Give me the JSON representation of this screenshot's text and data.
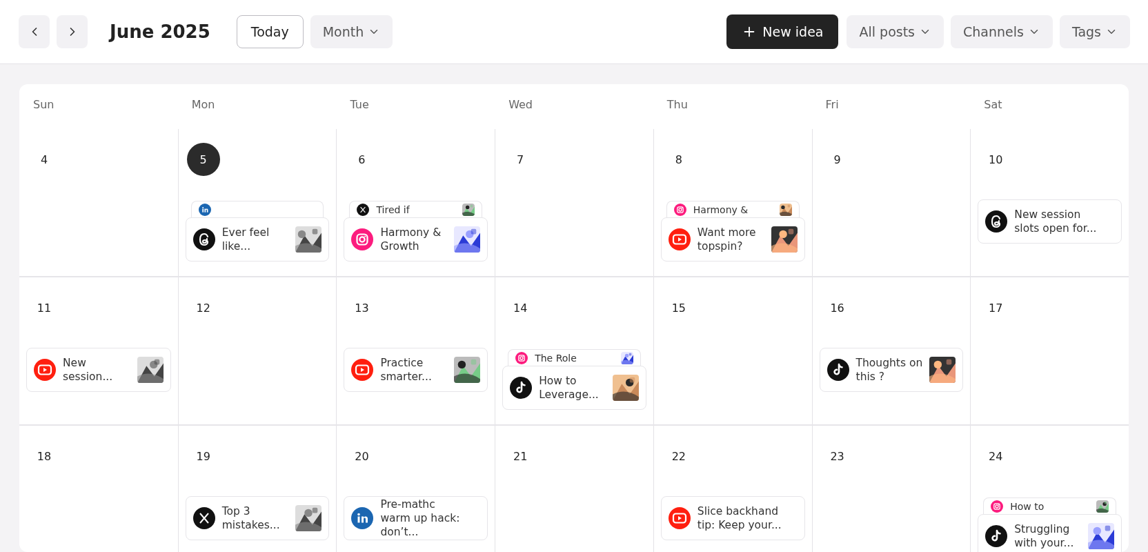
{
  "toolbar": {
    "title": "June 2025",
    "today": "Today",
    "view": "Month",
    "new_idea": "New idea",
    "filters": [
      "All posts",
      "Channels",
      "Tags"
    ]
  },
  "weekdays": [
    "Sun",
    "Mon",
    "Tue",
    "Wed",
    "Thu",
    "Fri",
    "Sat"
  ],
  "weeks": [
    {
      "days": [
        {
          "date": "4",
          "today": false
        },
        {
          "date": "5",
          "today": true,
          "posts": [
            {
              "kind": "linkedin",
              "thumbnail": false
            },
            {
              "kind": "threads",
              "title": "Ever feel like...",
              "thumbnail": true
            }
          ]
        },
        {
          "date": "6",
          "today": false,
          "posts": [
            {
              "kind": "x",
              "title": "Tired if",
              "thumbnail": true
            },
            {
              "kind": "instagram",
              "title": "Harmony & Growth",
              "thumbnail": true
            }
          ]
        },
        {
          "date": "7",
          "today": false
        },
        {
          "date": "8",
          "today": false,
          "posts": [
            {
              "kind": "instagram",
              "title": "Harmony &",
              "thumbnail": true
            },
            {
              "kind": "youtube",
              "title": "Want more topspin?",
              "thumbnail": true
            }
          ]
        },
        {
          "date": "9",
          "today": false
        },
        {
          "date": "10",
          "today": false,
          "posts": [
            {
              "kind": "threads",
              "title": "New session slots open for...",
              "thumbnail": false
            }
          ]
        }
      ]
    },
    {
      "days": [
        {
          "date": "11",
          "today": false,
          "posts": [
            {
              "kind": "youtube",
              "title": "New session...",
              "thumbnail": true
            }
          ]
        },
        {
          "date": "12",
          "today": false
        },
        {
          "date": "13",
          "today": false,
          "posts": [
            {
              "kind": "youtube",
              "title": "Practice smarter...",
              "thumbnail": true
            }
          ]
        },
        {
          "date": "14",
          "today": false,
          "posts": [
            {
              "kind": "instagram",
              "title": "The Role",
              "thumbnail": true
            },
            {
              "kind": "tiktok",
              "title": "How to Leverage...",
              "thumbnail": true
            }
          ]
        },
        {
          "date": "15",
          "today": false
        },
        {
          "date": "16",
          "today": false,
          "posts": [
            {
              "kind": "tiktok",
              "title": "Thoughts on this ?",
              "thumbnail": true
            }
          ]
        },
        {
          "date": "17",
          "today": false
        }
      ]
    },
    {
      "days": [
        {
          "date": "18",
          "today": false
        },
        {
          "date": "19",
          "today": false,
          "posts": [
            {
              "kind": "x",
              "title": "Top 3 mistakes...",
              "thumbnail": true
            }
          ]
        },
        {
          "date": "20",
          "today": false,
          "posts": [
            {
              "kind": "linkedin",
              "title": "Pre-mathc warm up hack: don’t...",
              "thumbnail": false
            }
          ]
        },
        {
          "date": "21",
          "today": false
        },
        {
          "date": "22",
          "today": false,
          "posts": [
            {
              "kind": "youtube",
              "title": "Slice backhand tip: Keep your...",
              "thumbnail": false
            }
          ]
        },
        {
          "date": "23",
          "today": false
        },
        {
          "date": "24",
          "today": false,
          "posts": [
            {
              "kind": "instagram",
              "title": "How to",
              "thumbnail": true
            },
            {
              "kind": "tiktok",
              "title": "Struggling with your...",
              "thumbnail": true
            }
          ]
        }
      ]
    }
  ]
}
